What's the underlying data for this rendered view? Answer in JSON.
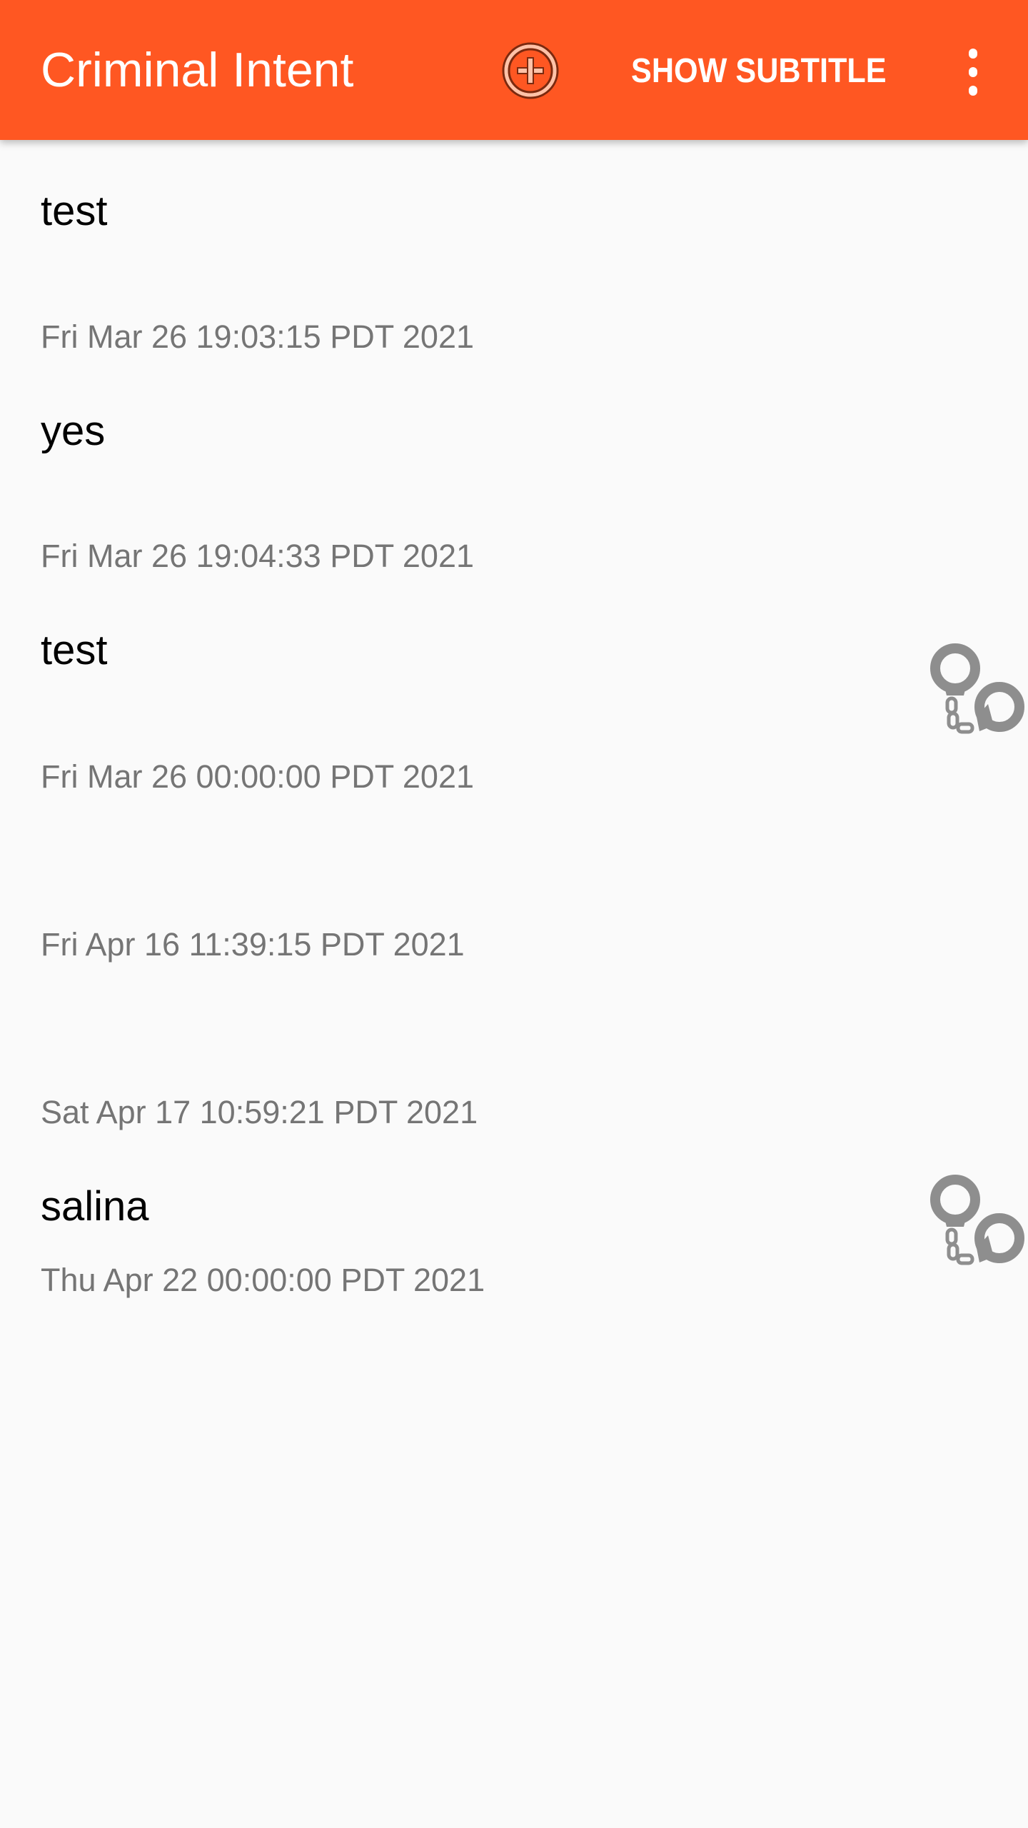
{
  "toolbar": {
    "title": "Criminal Intent",
    "add_icon": "add-circle-icon",
    "show_subtitle_label": "SHOW SUBTITLE",
    "more_icon": "more-vert-icon",
    "color": "#ff5722"
  },
  "crimes": [
    {
      "title": "test",
      "date": "Fri Mar 26 19:03:15 PDT 2021",
      "solved": false
    },
    {
      "title": "yes",
      "date": "Fri Mar 26 19:04:33 PDT 2021",
      "solved": false
    },
    {
      "title": "test",
      "date": "Fri Mar 26 00:00:00 PDT 2021",
      "solved": true
    },
    {
      "title": "",
      "date": "Fri Apr 16 11:39:15 PDT 2021",
      "solved": false
    },
    {
      "title": "",
      "date": "Sat Apr 17 10:59:21 PDT 2021",
      "solved": false
    },
    {
      "title": "salina",
      "date": "Thu Apr 22 00:00:00 PDT 2021",
      "solved": true
    }
  ]
}
